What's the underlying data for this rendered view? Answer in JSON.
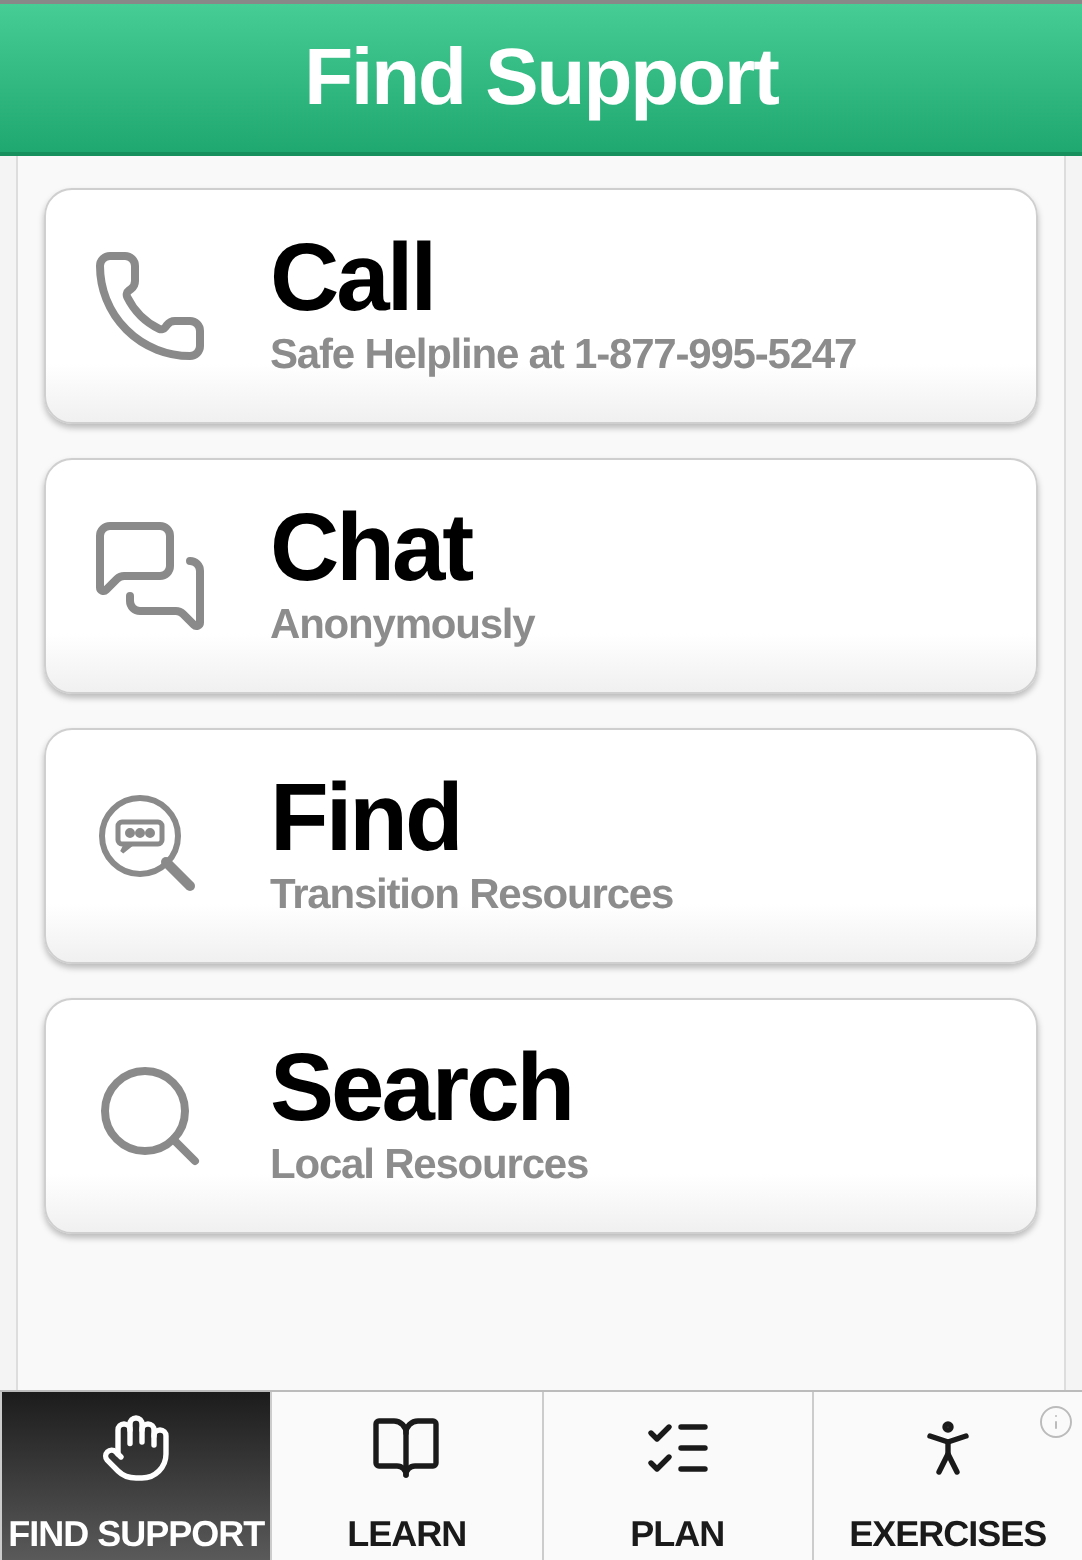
{
  "header": {
    "title": "Find Support"
  },
  "options": [
    {
      "kind": "call",
      "title": "Call",
      "subtitle": "Safe Helpline at 1-877-995-5247"
    },
    {
      "kind": "chat",
      "title": "Chat",
      "subtitle": "Anonymously"
    },
    {
      "kind": "find",
      "title": "Find",
      "subtitle": "Transition Resources"
    },
    {
      "kind": "search",
      "title": "Search",
      "subtitle": "Local Resources"
    }
  ],
  "tabs": [
    {
      "kind": "support",
      "label": "FIND SUPPORT",
      "selected": true
    },
    {
      "kind": "learn",
      "label": "LEARN",
      "selected": false
    },
    {
      "kind": "plan",
      "label": "PLAN",
      "selected": false
    },
    {
      "kind": "exercises",
      "label": "EXERCISES",
      "selected": false
    }
  ]
}
